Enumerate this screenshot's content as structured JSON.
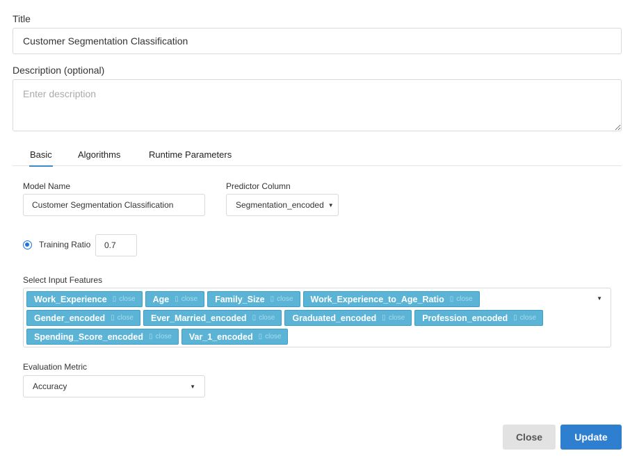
{
  "form": {
    "title_label": "Title",
    "title_value": "Customer Segmentation Classification",
    "description_label": "Description (optional)",
    "description_placeholder": "Enter description"
  },
  "tabs": [
    {
      "label": "Basic",
      "active": true
    },
    {
      "label": "Algorithms",
      "active": false
    },
    {
      "label": "Runtime Parameters",
      "active": false
    }
  ],
  "basic": {
    "model_name_label": "Model Name",
    "model_name_value": "Customer Segmentation Classification",
    "predictor_label": "Predictor Column",
    "predictor_value": "Segmentation_encoded",
    "training_ratio_label": "Training Ratio",
    "training_ratio_value": "0.7",
    "features_label": "Select Input Features",
    "features": [
      "Work_Experience",
      "Age",
      "Family_Size",
      "Work_Experience_to_Age_Ratio",
      "Gender_encoded",
      "Ever_Married_encoded",
      "Graduated_encoded",
      "Profession_encoded",
      "Spending_Score_encoded",
      "Var_1_encoded"
    ],
    "chip_close_text": "close",
    "metric_label": "Evaluation Metric",
    "metric_value": "Accuracy"
  },
  "actions": {
    "close_label": "Close",
    "update_label": "Update"
  },
  "colors": {
    "accent": "#2e7fd0",
    "chip": "#5bb4d6"
  }
}
